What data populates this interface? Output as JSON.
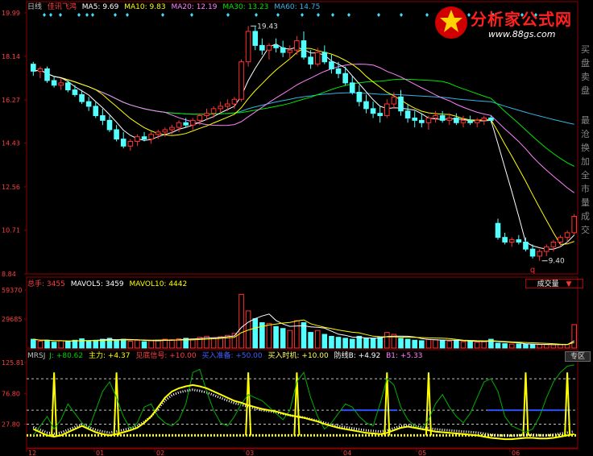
{
  "main_header": {
    "period": "日线",
    "stock": "佳讯飞鸿",
    "ma5": "MA5: 9.69",
    "ma10": "MA10: 9.83",
    "ma20": "MA20: 12.19",
    "ma30": "MA30: 13.23",
    "ma60": "MA60: 14.75"
  },
  "vol_header": {
    "label": "总手: 3455",
    "mavol5": "MAVOL5: 3459",
    "mavol10": "MAVOL10: 4442",
    "dropdown": "成交量"
  },
  "ind_header": {
    "name": "MRSJ",
    "j": "J: +80.62",
    "zhuli": "主力: +4.37",
    "xinhao": "见底信号: +10.00",
    "zhunbei": "买入准备: +50.00",
    "shiji": "买入时机: +10.00",
    "fangxian": "防线B: +4.92",
    "b1": "B1: +5.33",
    "button": "专区"
  },
  "logo": {
    "text": "分析家公式网",
    "url": "www.88gs.com"
  },
  "side_chars": [
    "买",
    "盘",
    "卖",
    "盘",
    "最",
    "沧",
    "换",
    "加",
    "全",
    "市",
    "量",
    "成",
    "交"
  ],
  "colors": {
    "up": "#ff3232",
    "down": "#54ffff",
    "ma5": "#ffffff",
    "ma10": "#ffff00",
    "ma20": "#ff80ff",
    "ma30": "#00e600",
    "ma60": "#33b5e5",
    "grid": "#8b0000",
    "axis": "#c0c0c0"
  },
  "chart_data": [
    {
      "type": "candlestick",
      "panel": "price",
      "y_ticks": [
        "19.99",
        "18.14",
        "16.27",
        "14.43",
        "12.56",
        "10.71",
        "8.84"
      ],
      "ylim": [
        8.84,
        19.99
      ],
      "x_ticks": [
        "12",
        "01",
        "02",
        "03",
        "04",
        "05",
        "06"
      ],
      "annotations": [
        {
          "text": "19.43",
          "value": 19.43
        },
        {
          "text": "9.40",
          "value": 9.4
        },
        {
          "text": "q"
        }
      ],
      "ohlc": [
        [
          17.8,
          17.9,
          17.3,
          17.5
        ],
        [
          17.5,
          17.7,
          17.2,
          17.6
        ],
        [
          17.6,
          17.7,
          17.0,
          17.1
        ],
        [
          17.1,
          17.3,
          16.8,
          16.9
        ],
        [
          16.9,
          17.2,
          16.7,
          17.0
        ],
        [
          17.0,
          17.1,
          16.6,
          16.7
        ],
        [
          16.7,
          16.9,
          16.4,
          16.5
        ],
        [
          16.5,
          16.7,
          16.1,
          16.2
        ],
        [
          16.2,
          16.4,
          15.8,
          16.0
        ],
        [
          16.0,
          16.2,
          15.5,
          15.6
        ],
        [
          15.6,
          15.9,
          15.2,
          15.4
        ],
        [
          15.4,
          15.6,
          14.9,
          15.0
        ],
        [
          15.0,
          15.2,
          14.5,
          14.6
        ],
        [
          14.6,
          14.9,
          14.2,
          14.3
        ],
        [
          14.3,
          14.6,
          14.1,
          14.5
        ],
        [
          14.5,
          14.8,
          14.3,
          14.7
        ],
        [
          14.7,
          14.9,
          14.5,
          14.6
        ],
        [
          14.6,
          14.9,
          14.4,
          14.8
        ],
        [
          14.8,
          15.0,
          14.6,
          14.9
        ],
        [
          14.9,
          15.1,
          14.7,
          15.0
        ],
        [
          15.0,
          15.2,
          14.8,
          15.1
        ],
        [
          15.1,
          15.4,
          14.9,
          15.3
        ],
        [
          15.3,
          15.5,
          15.1,
          15.2
        ],
        [
          15.2,
          15.5,
          15.0,
          15.4
        ],
        [
          15.4,
          15.7,
          15.2,
          15.6
        ],
        [
          15.6,
          15.9,
          15.4,
          15.7
        ],
        [
          15.7,
          16.0,
          15.5,
          15.9
        ],
        [
          15.9,
          16.2,
          15.7,
          16.0
        ],
        [
          16.0,
          16.3,
          15.8,
          16.1
        ],
        [
          16.1,
          16.4,
          15.9,
          16.3
        ],
        [
          16.3,
          18.0,
          16.2,
          17.9
        ],
        [
          17.9,
          19.43,
          17.7,
          19.2
        ],
        [
          19.2,
          19.4,
          18.4,
          18.6
        ],
        [
          18.6,
          18.9,
          18.2,
          18.4
        ],
        [
          18.4,
          18.7,
          18.0,
          18.6
        ],
        [
          18.6,
          18.9,
          18.3,
          18.5
        ],
        [
          18.5,
          18.8,
          18.1,
          18.3
        ],
        [
          18.3,
          18.6,
          18.0,
          18.4
        ],
        [
          18.4,
          19.0,
          18.2,
          18.8
        ],
        [
          18.8,
          19.2,
          18.0,
          18.1
        ],
        [
          18.1,
          18.4,
          17.6,
          17.8
        ],
        [
          17.8,
          18.5,
          17.7,
          18.3
        ],
        [
          18.3,
          18.6,
          17.8,
          17.9
        ],
        [
          17.9,
          18.2,
          17.4,
          17.6
        ],
        [
          17.6,
          17.9,
          17.2,
          17.4
        ],
        [
          17.4,
          17.7,
          16.9,
          17.0
        ],
        [
          17.0,
          17.3,
          16.5,
          16.6
        ],
        [
          16.6,
          16.9,
          16.0,
          16.2
        ],
        [
          16.2,
          16.5,
          15.7,
          15.9
        ],
        [
          15.9,
          16.2,
          15.5,
          15.7
        ],
        [
          15.7,
          16.0,
          15.3,
          15.6
        ],
        [
          15.6,
          16.3,
          15.5,
          16.1
        ],
        [
          16.1,
          16.6,
          15.9,
          16.4
        ],
        [
          16.4,
          16.7,
          15.6,
          15.8
        ],
        [
          15.8,
          16.1,
          15.3,
          15.5
        ],
        [
          15.5,
          15.8,
          15.1,
          15.4
        ],
        [
          15.4,
          15.7,
          15.1,
          15.3
        ],
        [
          15.3,
          15.6,
          15.0,
          15.5
        ],
        [
          15.5,
          15.8,
          15.3,
          15.6
        ],
        [
          15.6,
          15.8,
          15.3,
          15.4
        ],
        [
          15.4,
          15.7,
          15.2,
          15.5
        ],
        [
          15.5,
          15.7,
          15.2,
          15.3
        ],
        [
          15.3,
          15.6,
          15.1,
          15.4
        ],
        [
          15.4,
          15.6,
          15.2,
          15.3
        ],
        [
          15.3,
          15.5,
          15.1,
          15.4
        ],
        [
          15.4,
          15.6,
          15.2,
          15.5
        ],
        [
          15.5,
          15.6,
          15.3,
          15.4
        ],
        [
          11.0,
          11.2,
          10.3,
          10.4
        ],
        [
          10.4,
          10.6,
          10.1,
          10.2
        ],
        [
          10.2,
          10.4,
          10.0,
          10.3
        ],
        [
          10.3,
          10.5,
          10.1,
          10.2
        ],
        [
          10.2,
          10.4,
          9.8,
          9.9
        ],
        [
          9.9,
          10.1,
          9.5,
          9.6
        ],
        [
          9.6,
          9.9,
          9.4,
          9.8
        ],
        [
          9.8,
          10.1,
          9.6,
          10.0
        ],
        [
          10.0,
          10.3,
          9.8,
          10.2
        ],
        [
          10.2,
          10.5,
          10.0,
          10.4
        ],
        [
          10.4,
          10.7,
          10.2,
          10.6
        ],
        [
          10.6,
          11.4,
          10.5,
          11.3
        ]
      ],
      "ma_periods": {
        "ma5": 5,
        "ma10": 10,
        "ma20": 20,
        "ma30": 30,
        "ma60": 60
      }
    },
    {
      "type": "bar",
      "panel": "volume",
      "y_ticks": [
        "59370",
        "29685"
      ],
      "ylim": [
        0,
        59370
      ],
      "values": [
        9000,
        7000,
        8000,
        6000,
        7500,
        6500,
        8000,
        9500,
        7000,
        8000,
        9000,
        10000,
        8500,
        9000,
        7000,
        8000,
        6500,
        7500,
        8000,
        9000,
        8500,
        9500,
        10000,
        9000,
        11000,
        12000,
        10500,
        11500,
        13000,
        15000,
        55000,
        38000,
        30000,
        26000,
        25000,
        22000,
        20000,
        18000,
        28000,
        26000,
        16000,
        18000,
        14000,
        12000,
        11000,
        10000,
        9000,
        12000,
        10000,
        9500,
        11000,
        16000,
        14000,
        10000,
        9000,
        8000,
        7500,
        9000,
        8500,
        8000,
        7000,
        7500,
        6500,
        7000,
        6000,
        6500,
        9000,
        5000,
        4500,
        4000,
        4200,
        3800,
        3600,
        3500,
        3400,
        3300,
        3455,
        3500,
        24000
      ],
      "colors_up_down": "follow price"
    },
    {
      "type": "line",
      "panel": "indicator",
      "y_ticks": [
        "125.81",
        "76.80",
        "27.80"
      ],
      "ylim": [
        -10,
        125.81
      ],
      "series": [
        {
          "name": "J",
          "color": "#00b000",
          "values": [
            10,
            25,
            40,
            20,
            35,
            60,
            45,
            30,
            20,
            50,
            80,
            95,
            70,
            40,
            20,
            30,
            55,
            60,
            40,
            30,
            25,
            35,
            60,
            110,
            115,
            80,
            50,
            30,
            25,
            40,
            60,
            75,
            70,
            65,
            55,
            45,
            35,
            50,
            95,
            110,
            70,
            40,
            20,
            30,
            45,
            60,
            55,
            40,
            30,
            25,
            60,
            100,
            90,
            55,
            35,
            25,
            20,
            35,
            60,
            75,
            55,
            40,
            30,
            45,
            70,
            95,
            100,
            80,
            40,
            25,
            20,
            15,
            20,
            40,
            70,
            95,
            110,
            120,
            122
          ]
        },
        {
          "name": "主力",
          "color": "#ffff00",
          "values": [
            20,
            15,
            10,
            8,
            10,
            15,
            20,
            25,
            20,
            15,
            12,
            10,
            12,
            15,
            18,
            22,
            30,
            40,
            55,
            70,
            80,
            85,
            88,
            90,
            88,
            85,
            80,
            75,
            70,
            65,
            62,
            58,
            55,
            52,
            50,
            48,
            45,
            42,
            40,
            38,
            35,
            32,
            28,
            25,
            22,
            20,
            18,
            16,
            14,
            13,
            12,
            14,
            18,
            22,
            24,
            22,
            20,
            18,
            16,
            15,
            14,
            13,
            12,
            11,
            10,
            8,
            6,
            5,
            4,
            4,
            5,
            6,
            6,
            5,
            5,
            6,
            8,
            10,
            12
          ]
        }
      ],
      "signals": {
        "见底信号": 10,
        "买入准备": 50,
        "买入时机": 10
      },
      "thresholds": [
        100,
        50,
        27.8
      ]
    }
  ]
}
